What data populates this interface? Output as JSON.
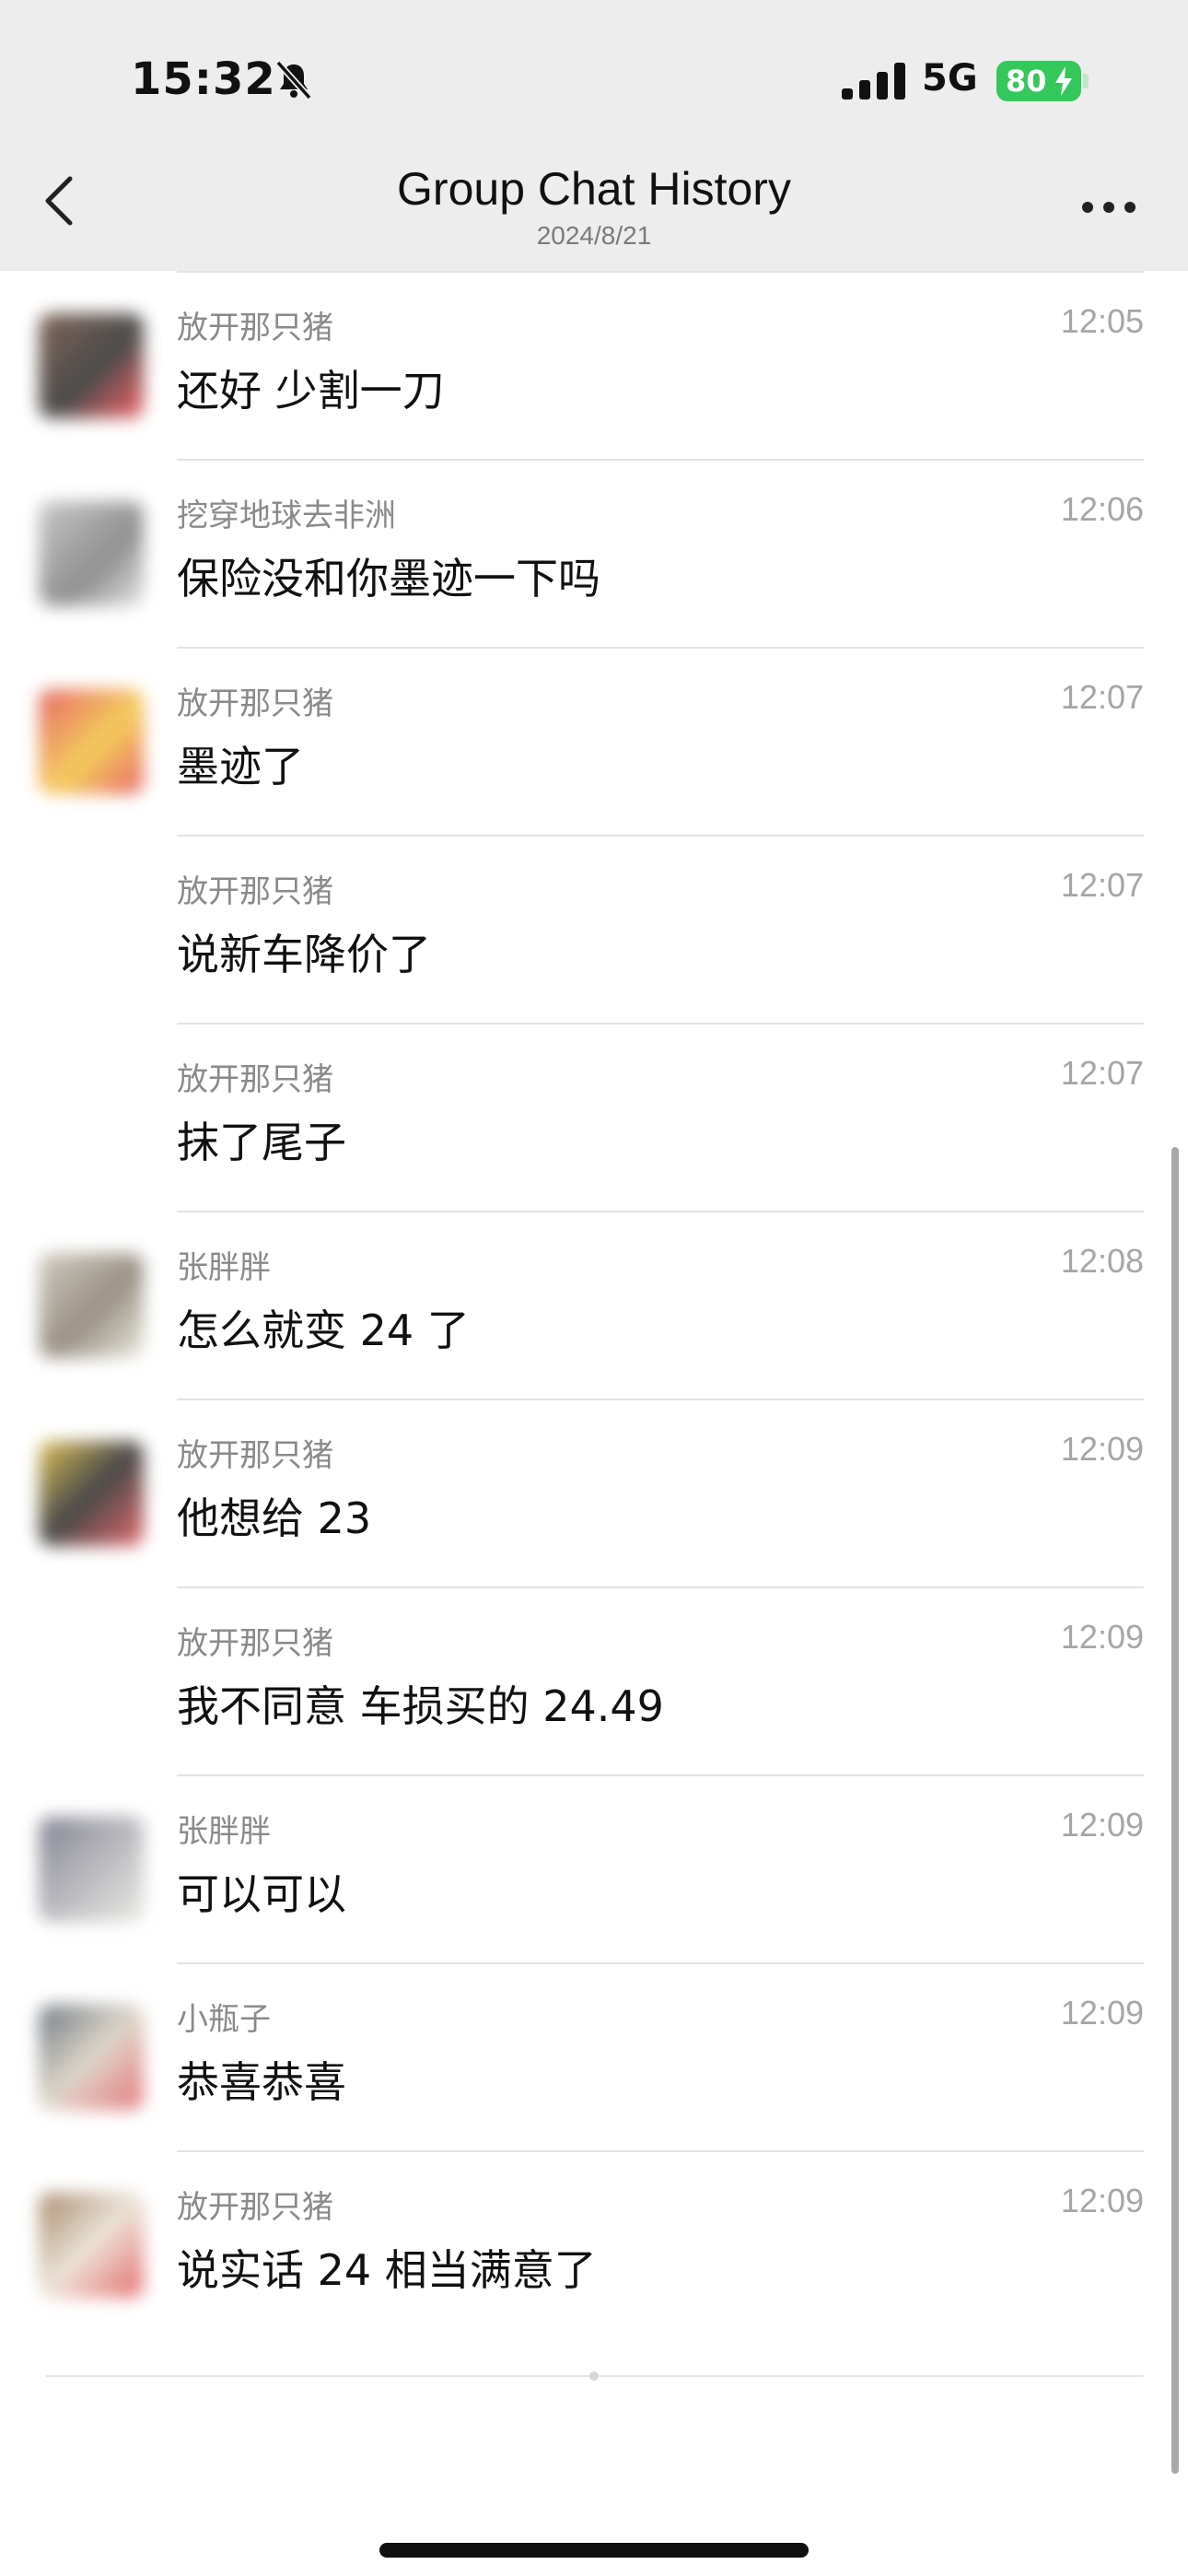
{
  "status_bar": {
    "time": "15:32",
    "network": "5G",
    "battery": "80",
    "icons": [
      "bell-slash-icon",
      "signal-icon",
      "charging-bolt-icon"
    ]
  },
  "nav": {
    "title": "Group Chat History",
    "subtitle": "2024/8/21",
    "icons": [
      "chevron-left-icon",
      "more-icon"
    ]
  },
  "colors": {
    "battery": "#34c759",
    "background_top": "#ededed",
    "sender": "#8a8a8a",
    "time": "#a6a6a6"
  },
  "messages": [
    {
      "sender": "放开那只猪",
      "time": "12:05",
      "text": "还好 少割一刀",
      "avatar": true
    },
    {
      "sender": "挖穿地球去非洲",
      "time": "12:06",
      "text": "保险没和你墨迹一下吗",
      "avatar": true
    },
    {
      "sender": "放开那只猪",
      "time": "12:07",
      "text": "墨迹了",
      "avatar": true
    },
    {
      "sender": "放开那只猪",
      "time": "12:07",
      "text": "说新车降价了",
      "avatar": false
    },
    {
      "sender": "放开那只猪",
      "time": "12:07",
      "text": "抹了尾子",
      "avatar": false
    },
    {
      "sender": "张胖胖",
      "time": "12:08",
      "text": "怎么就变 24 了",
      "avatar": true
    },
    {
      "sender": "放开那只猪",
      "time": "12:09",
      "text": "他想给 23",
      "avatar": true
    },
    {
      "sender": "放开那只猪",
      "time": "12:09",
      "text": "我不同意 车损买的 24.49",
      "avatar": false
    },
    {
      "sender": "张胖胖",
      "time": "12:09",
      "text": "可以可以",
      "avatar": true
    },
    {
      "sender": "小瓶子",
      "time": "12:09",
      "text": "恭喜恭喜",
      "avatar": true
    },
    {
      "sender": "放开那只猪",
      "time": "12:09",
      "text": "说实话 24 相当满意了",
      "avatar": true
    }
  ]
}
